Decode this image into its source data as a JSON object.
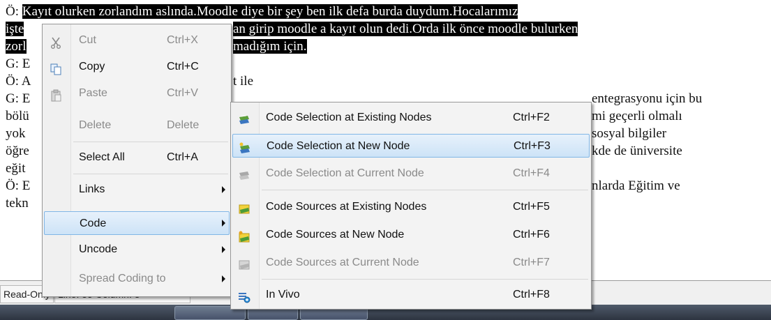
{
  "document": {
    "line1_prefix": "Ö: ",
    "line1_selected": "Kayıt olurken zorlandım aslında.Moodle diye bir şey ben ilk defa burda duydum.Hocalarımız",
    "line2_left": "işte",
    "line2_right": "an girip moodle a kayıt olun dedi.Orda ilk önce moodle bulurken",
    "line3_left": "zorl",
    "line3_right": "madığım için.",
    "line4": "G: E",
    "line5": "Ö: A",
    "line5_tail": "t ile",
    "line6": "G: E",
    "line6_right": "entegrasyonu için bu",
    "line7": "bölü",
    "line7_right": "mi geçerli olmalı",
    "line8": "yok",
    "line8_right": "sosyal bilgiler",
    "line9": "öğre",
    "line9_right": "kde de üniversite",
    "line10": "eğit",
    "line11": "Ö: E",
    "line11_right": "nlarda Eğitim ve",
    "line12": "tekn"
  },
  "statusbar": {
    "mode": "Read-Only",
    "position": "Line: 35 Column: 3"
  },
  "context_menu": {
    "items": [
      {
        "label": "Cut",
        "shortcut": "Ctrl+X",
        "enabled": false,
        "icon": "scissors-icon"
      },
      {
        "label": "Copy",
        "shortcut": "Ctrl+C",
        "enabled": true,
        "icon": "copy-icon"
      },
      {
        "label": "Paste",
        "shortcut": "Ctrl+V",
        "enabled": false,
        "icon": "paste-icon"
      },
      {
        "label": "Delete",
        "shortcut": "Delete",
        "enabled": false
      },
      {
        "label": "Select All",
        "shortcut": "Ctrl+A",
        "enabled": true
      },
      {
        "label": "Links",
        "submenu": true
      },
      {
        "label": "Code",
        "submenu": true,
        "highlighted": true
      },
      {
        "label": "Uncode",
        "submenu": true
      },
      {
        "label": "Spread Coding to",
        "submenu": true,
        "enabled": false
      }
    ]
  },
  "code_submenu": {
    "items": [
      {
        "label": "Code Selection at Existing Nodes",
        "shortcut": "Ctrl+F2",
        "enabled": true,
        "icon": "code-selection-existing-icon"
      },
      {
        "label": "Code Selection at New Node",
        "shortcut": "Ctrl+F3",
        "enabled": true,
        "highlighted": true,
        "icon": "code-selection-new-icon"
      },
      {
        "label": "Code Selection at Current Node",
        "shortcut": "Ctrl+F4",
        "enabled": false,
        "icon": "code-selection-current-icon"
      },
      {
        "label": "Code Sources at Existing Nodes",
        "shortcut": "Ctrl+F5",
        "enabled": true,
        "icon": "code-sources-existing-icon"
      },
      {
        "label": "Code Sources at New Node",
        "shortcut": "Ctrl+F6",
        "enabled": true,
        "icon": "code-sources-new-icon"
      },
      {
        "label": "Code Sources at Current Node",
        "shortcut": "Ctrl+F7",
        "enabled": false,
        "icon": "code-sources-current-icon"
      },
      {
        "label": "In Vivo",
        "shortcut": "Ctrl+F8",
        "enabled": true,
        "icon": "in-vivo-icon"
      }
    ]
  },
  "colors": {
    "selection": "#000000",
    "menu_highlight": "#cde3f7",
    "menu_highlight_border": "#80b6e6",
    "disabled_text": "#8a8a8a"
  }
}
